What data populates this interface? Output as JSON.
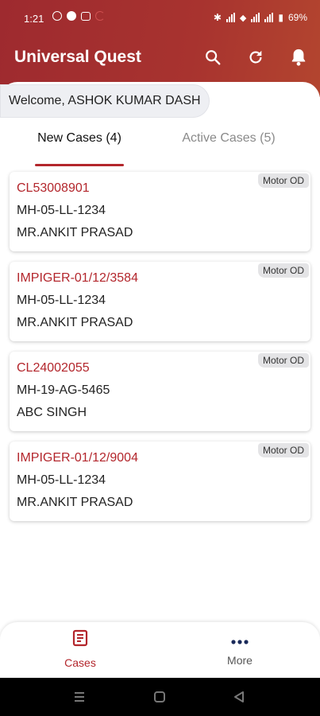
{
  "status_bar": {
    "time": "1:21",
    "battery": "69%"
  },
  "app": {
    "title": "Universal Quest",
    "brand_color": "#a8332f",
    "accent_color": "#b3262c"
  },
  "header_icons": [
    "search-icon",
    "refresh-icon",
    "bell-icon"
  ],
  "welcome": {
    "text": "Welcome, ASHOK KUMAR DASH"
  },
  "tabs": [
    {
      "label": "New Cases (4)",
      "active": true
    },
    {
      "label": "Active Cases (5)",
      "active": false
    }
  ],
  "cases": [
    {
      "id": "CL53008901",
      "vehicle": "MH-05-LL-1234",
      "name": "MR.ANKIT PRASAD",
      "type": "Motor OD"
    },
    {
      "id": "IMPIGER-01/12/3584",
      "vehicle": "MH-05-LL-1234",
      "name": "MR.ANKIT PRASAD",
      "type": "Motor OD"
    },
    {
      "id": "CL24002055",
      "vehicle": "MH-19-AG-5465",
      "name": "ABC SINGH",
      "type": "Motor OD"
    },
    {
      "id": "IMPIGER-01/12/9004",
      "vehicle": "MH-05-LL-1234",
      "name": "MR.ANKIT PRASAD",
      "type": "Motor OD"
    }
  ],
  "bottom_nav": [
    {
      "label": "Cases",
      "icon": "document-icon",
      "active": true
    },
    {
      "label": "More",
      "icon": "more-dots-icon",
      "active": false
    }
  ]
}
